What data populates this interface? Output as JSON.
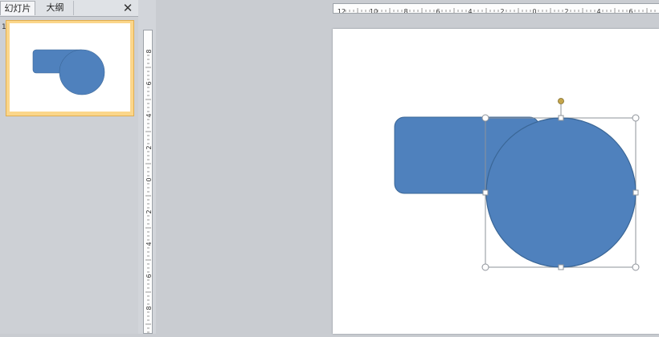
{
  "panel": {
    "tabs": [
      {
        "label": "幻灯片",
        "active": true
      },
      {
        "label": "大纲",
        "active": false
      }
    ],
    "close_symbol": "✕",
    "slide_number": "1"
  },
  "rulers": {
    "horizontal_labels": [
      "12",
      "10",
      "8",
      "6",
      "4",
      "2",
      "0",
      "2",
      "4",
      "6"
    ],
    "vertical_labels": [
      "8",
      "6",
      "4",
      "2",
      "0",
      "2",
      "4",
      "6",
      "8"
    ]
  },
  "shapes": {
    "fill_color": "#4f81bd",
    "stroke_color": "#3a6696",
    "handle_color": "#c5a54a"
  },
  "colors": {
    "thumbnail_selected": "#fbd68a",
    "workspace": "#c9ccd1"
  }
}
